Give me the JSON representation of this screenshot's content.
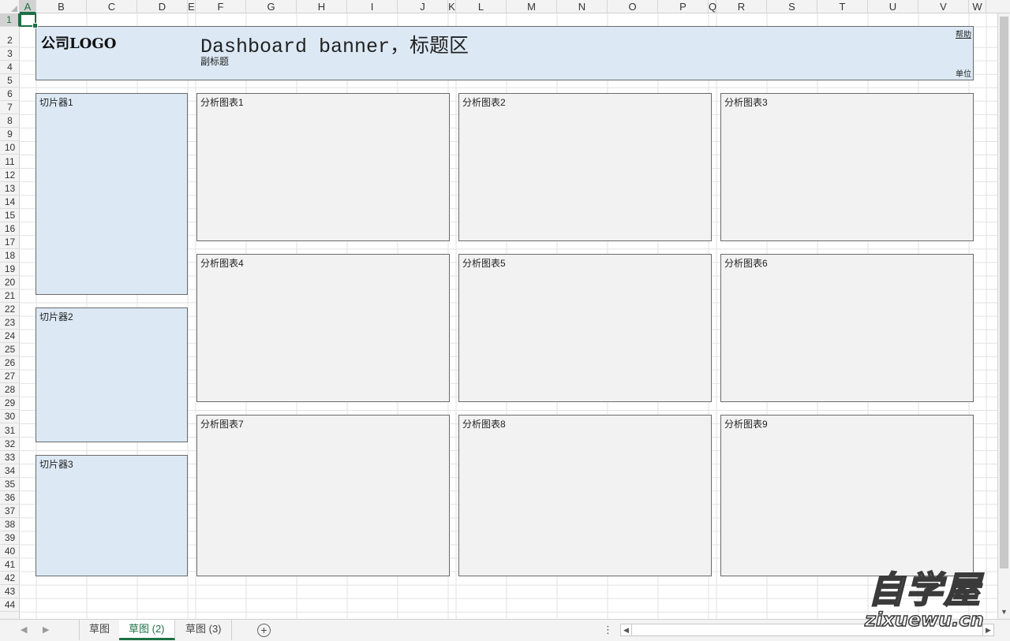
{
  "columns": [
    "A",
    "B",
    "C",
    "D",
    "E",
    "F",
    "G",
    "H",
    "I",
    "J",
    "K",
    "L",
    "M",
    "N",
    "O",
    "P",
    "Q",
    "R",
    "S",
    "T",
    "U",
    "V",
    "W"
  ],
  "rows": [
    "1",
    "2",
    "3",
    "4",
    "5",
    "6",
    "7",
    "8",
    "9",
    "10",
    "11",
    "12",
    "13",
    "14",
    "15",
    "16",
    "17",
    "18",
    "19",
    "20",
    "21",
    "22",
    "23",
    "24",
    "25",
    "26",
    "27",
    "28",
    "29",
    "30",
    "31",
    "32",
    "33",
    "34",
    "35",
    "36",
    "37",
    "38",
    "39",
    "40",
    "41",
    "42",
    "43",
    "44"
  ],
  "selected_cell": "A1",
  "banner": {
    "logo": "公司LOGO",
    "title": "Dashboard banner，标题区",
    "subtitle": "副标题",
    "help": "帮助",
    "unit": "单位",
    "background": "#dce9f5"
  },
  "slicers": [
    {
      "label": "切片器1"
    },
    {
      "label": "切片器2"
    },
    {
      "label": "切片器3"
    }
  ],
  "charts": [
    {
      "label": "分析图表1"
    },
    {
      "label": "分析图表2"
    },
    {
      "label": "分析图表3"
    },
    {
      "label": "分析图表4"
    },
    {
      "label": "分析图表5"
    },
    {
      "label": "分析图表6"
    },
    {
      "label": "分析图表7"
    },
    {
      "label": "分析图表8"
    },
    {
      "label": "分析图表9"
    }
  ],
  "sheet_tabs": [
    {
      "label": "草图",
      "active": false
    },
    {
      "label": "草图 (2)",
      "active": true
    },
    {
      "label": "草图 (3)",
      "active": false
    }
  ],
  "add_sheet_label": "+",
  "tab_menu_label": "⋮",
  "watermark": {
    "main": "自学屋",
    "url": "zixuewu.cn"
  },
  "accent_color": "#1e7145"
}
